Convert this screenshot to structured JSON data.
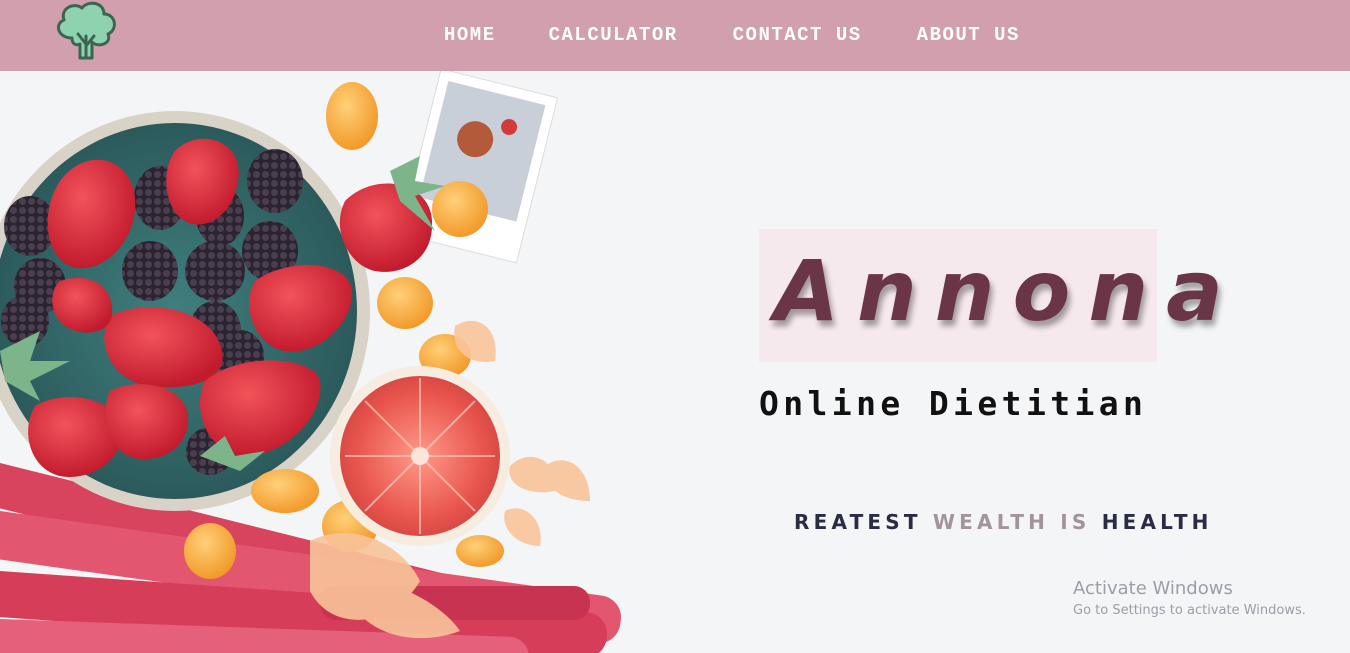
{
  "colors": {
    "navbar_bg": "#d29fae",
    "brand_text": "#6b3548",
    "brand_box": "#f6e9ee",
    "tagline_dark": "#2a2b45",
    "tagline_light": "#a3939c",
    "page_bg": "#f4f5f7"
  },
  "logo": {
    "icon": "broccoli-tree-icon"
  },
  "nav": {
    "items": [
      {
        "label": "HOME"
      },
      {
        "label": "CALCULATOR"
      },
      {
        "label": "CONTACT US"
      },
      {
        "label": "ABOUT US"
      }
    ]
  },
  "hero": {
    "image": "fruit-bowl-strawberries-blackberries-grapefruit-rhubarb",
    "brand": "Annona",
    "subtitle": "Online Dietitian",
    "tagline": {
      "part1": "REATEST ",
      "part2": "WEALTH IS ",
      "part3": "HEALTH"
    }
  },
  "watermark": {
    "title": "Activate Windows",
    "subtitle": "Go to Settings to activate Windows."
  }
}
